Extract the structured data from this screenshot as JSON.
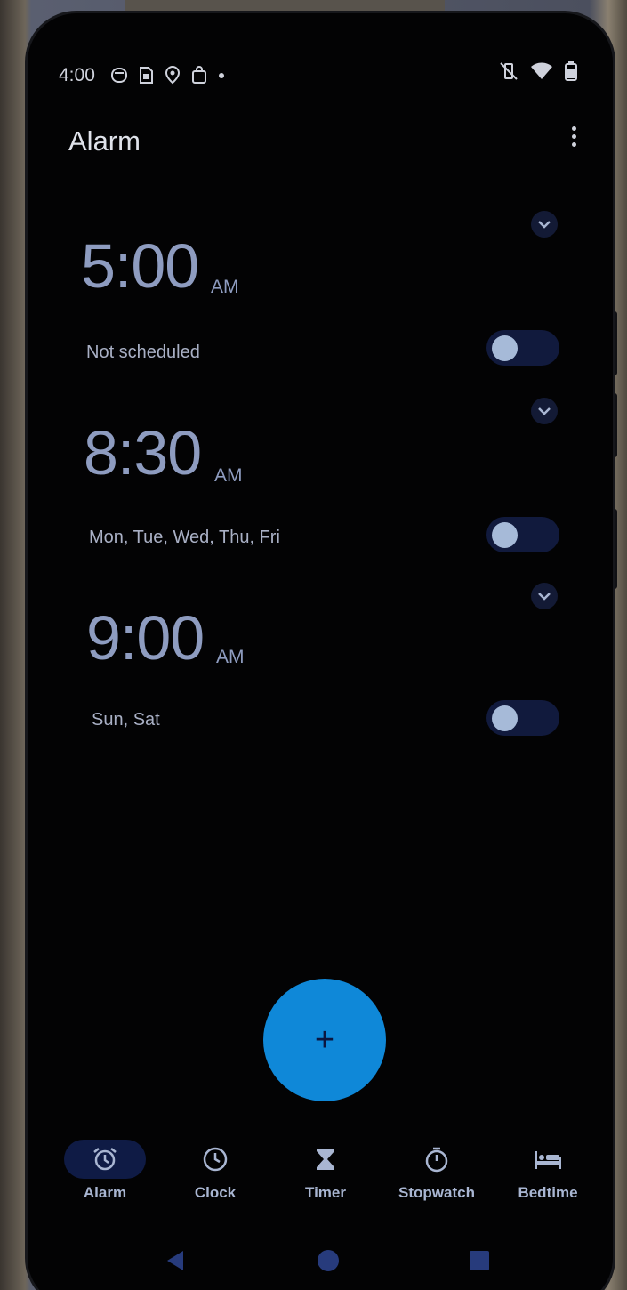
{
  "status_bar": {
    "time": "4:00",
    "left_icons": [
      "app-notification-icon",
      "sim-card-icon",
      "map-pin-icon",
      "shopping-bag-icon",
      "dot-icon"
    ],
    "right_icons": [
      "vibrate-off-icon",
      "wifi-icon",
      "battery-icon"
    ]
  },
  "header": {
    "title": "Alarm"
  },
  "alarms": [
    {
      "time": "5:00",
      "ampm": "AM",
      "days": "Not scheduled",
      "enabled": false
    },
    {
      "time": "8:30",
      "ampm": "AM",
      "days": "Mon, Tue, Wed, Thu, Fri",
      "enabled": false
    },
    {
      "time": "9:00",
      "ampm": "AM",
      "days": "Sun, Sat",
      "enabled": false
    }
  ],
  "fab": {
    "label": "+"
  },
  "bottom_nav": {
    "items": [
      {
        "label": "Alarm",
        "icon": "alarm-icon",
        "active": true
      },
      {
        "label": "Clock",
        "icon": "clock-icon",
        "active": false
      },
      {
        "label": "Timer",
        "icon": "hourglass-icon",
        "active": false
      },
      {
        "label": "Stopwatch",
        "icon": "stopwatch-icon",
        "active": false
      },
      {
        "label": "Bedtime",
        "icon": "bed-icon",
        "active": false
      }
    ]
  },
  "system_nav": [
    "back-icon",
    "home-icon",
    "recents-icon"
  ],
  "colors": {
    "background": "#030304",
    "alarm_time": "#8e9cc0",
    "fab": "#0f88d8",
    "active_nav_pill": "#0f1b45"
  }
}
